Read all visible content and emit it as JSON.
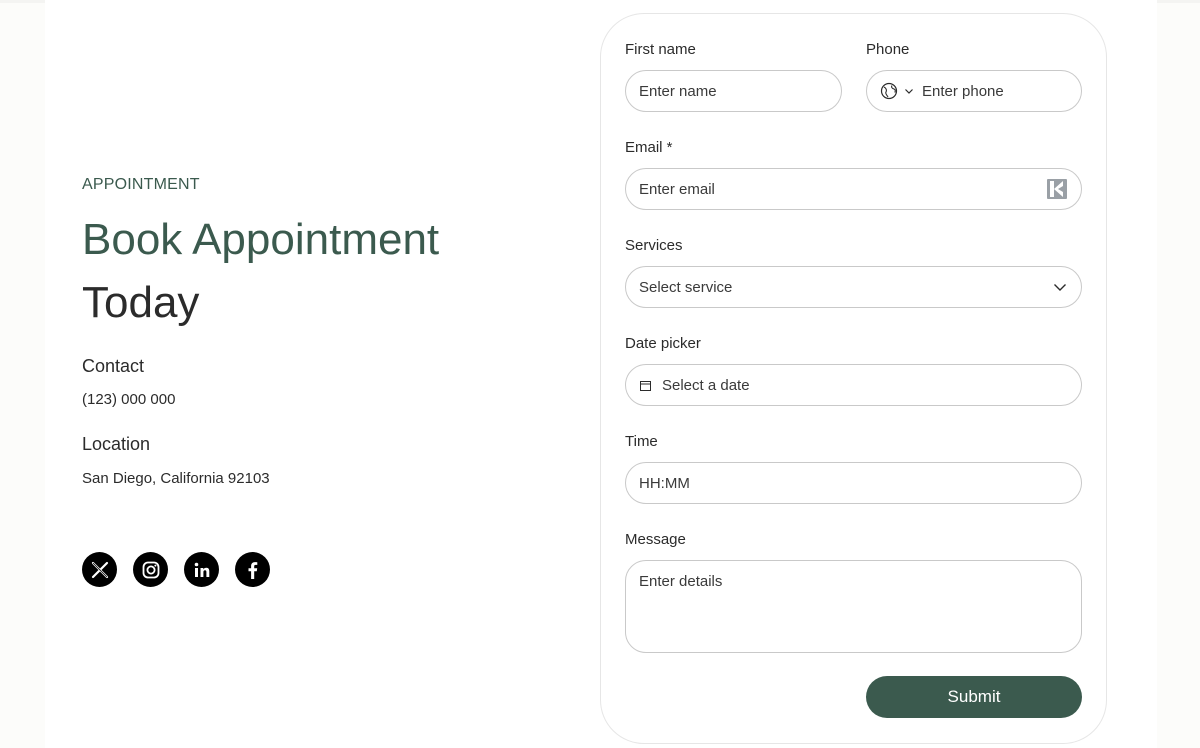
{
  "left": {
    "eyebrow": "APPOINTMENT",
    "headline_line1": "Book Appointment",
    "headline_line2": "Today",
    "contact_heading": "Contact",
    "contact_value": "(123) 000 000",
    "location_heading": "Location",
    "location_value": "San Diego, California 92103",
    "socials": [
      "x-icon",
      "instagram-icon",
      "linkedin-icon",
      "facebook-icon"
    ]
  },
  "form": {
    "first_name": {
      "label": "First name",
      "placeholder": "Enter name"
    },
    "phone": {
      "label": "Phone",
      "placeholder": "Enter phone"
    },
    "email": {
      "label": "Email *",
      "placeholder": "Enter email"
    },
    "services": {
      "label": "Services",
      "placeholder": "Select service"
    },
    "date": {
      "label": "Date picker",
      "placeholder": "Select a date"
    },
    "time": {
      "label": "Time",
      "placeholder": "HH:MM"
    },
    "message": {
      "label": "Message",
      "placeholder": "Enter details"
    },
    "submit_label": "Submit"
  },
  "colors": {
    "accent": "#3b5a4e",
    "text": "#2b2b2b",
    "border": "#c9c9c9",
    "page_bg": "#fcfcfa"
  }
}
